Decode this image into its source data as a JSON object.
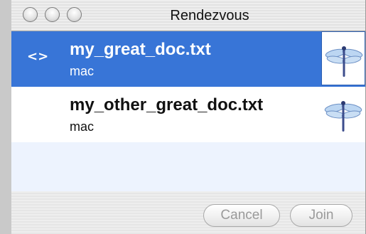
{
  "window": {
    "title": "Rendezvous"
  },
  "list": {
    "items": [
      {
        "name": "my_great_doc.txt",
        "host": "mac",
        "selected": true,
        "marker": "<>",
        "icon": "dragonfly-icon"
      },
      {
        "name": "my_other_great_doc.txt",
        "host": "mac",
        "selected": false,
        "icon": "dragonfly-icon"
      }
    ]
  },
  "buttons": {
    "cancel_label": "Cancel",
    "join_label": "Join"
  },
  "colors": {
    "selection": "#3875d7",
    "alt_row": "#edf3fe",
    "disabled_text": "#9a9a9a"
  }
}
